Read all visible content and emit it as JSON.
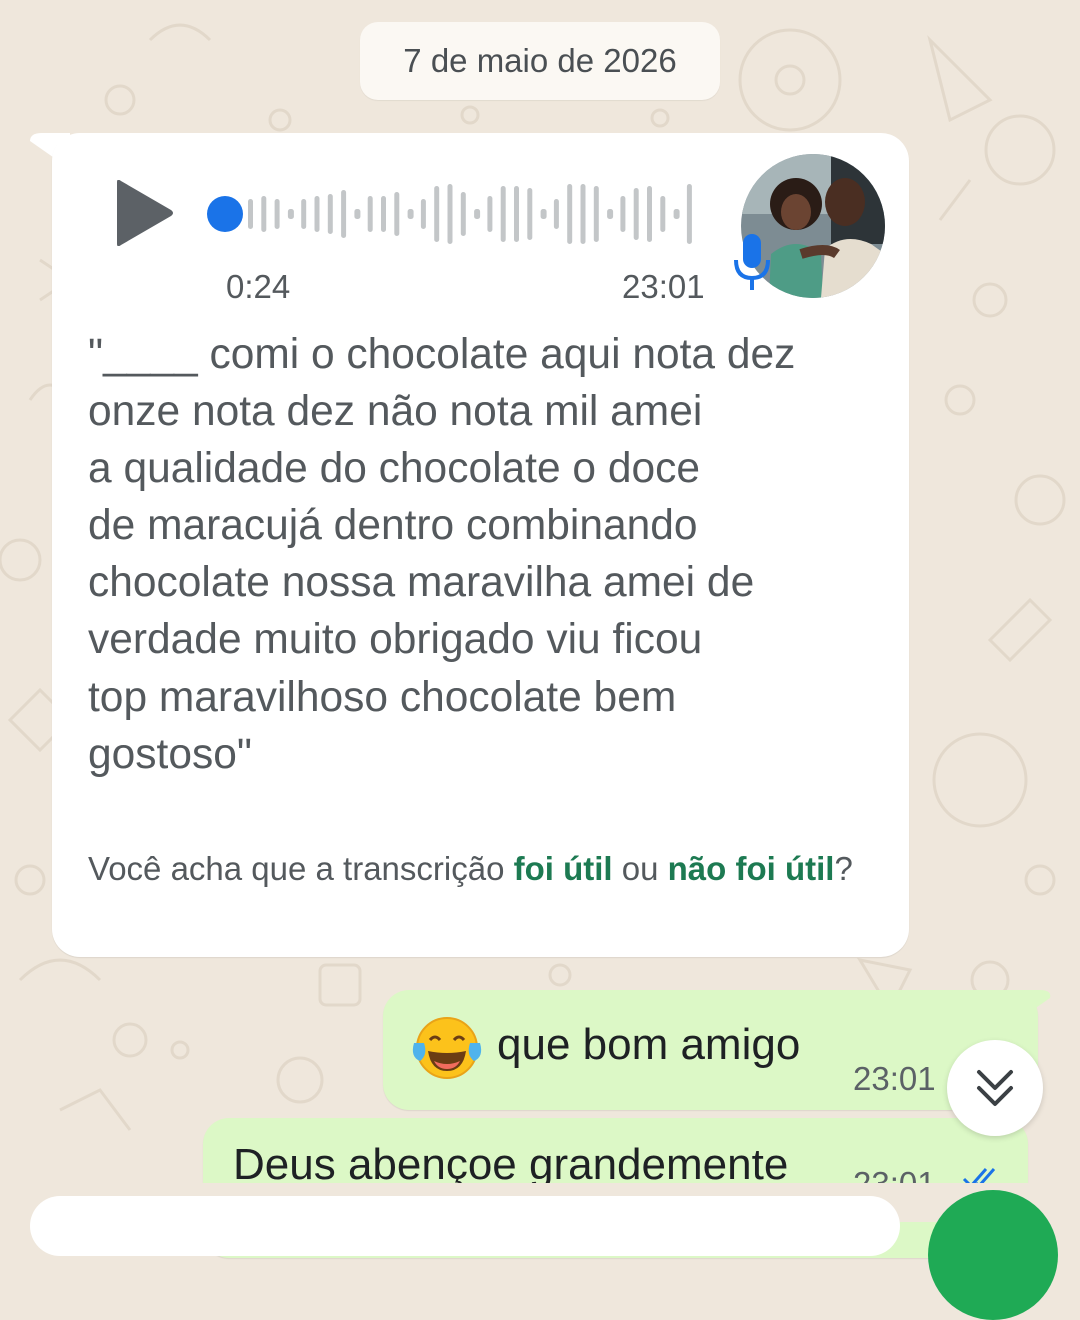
{
  "date_separator": "7 de maio de 2026",
  "voice_message": {
    "duration": "0:24",
    "time": "23:01",
    "transcript": "\"____ comi o chocolate aqui nota dez\nonze nota dez não nota mil amei\na qualidade do chocolate o doce\nde maracujá dentro combinando\nchocolate nossa maravilha amei de\nverdade muito obrigado viu ficou\ntop maravilhoso chocolate bem\ngostoso\"",
    "feedback_prefix": "Você acha que a transcrição ",
    "feedback_helpful": "foi útil",
    "feedback_or": " ou ",
    "feedback_not_helpful": "não foi útil",
    "feedback_suffix": "?",
    "accent_color": "#1a73e8"
  },
  "outgoing_messages": [
    {
      "emoji": "tears-of-joy-emoji",
      "text": "que bom amigo",
      "time": "23:01",
      "status": "read"
    },
    {
      "text": "Deus abençoe grandemente",
      "time": "23:01",
      "status": "read"
    }
  ],
  "colors": {
    "outgoing_bubble": "#dcf8c6",
    "link_green": "#1d7a52",
    "read_ticks": "#1a73e8",
    "fab": "#1faa55"
  },
  "icons": {
    "play": "play-icon",
    "mic": "microphone-icon",
    "scroll_down": "double-chevron-down-icon"
  }
}
